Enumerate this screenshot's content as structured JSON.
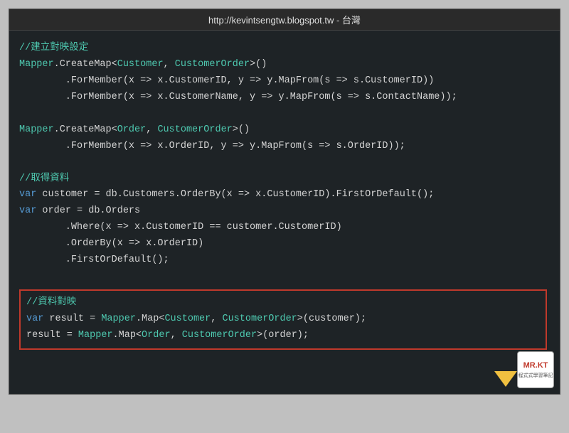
{
  "titleBar": {
    "text": "http://kevintsengtw.blogspot.tw - 台灣"
  },
  "code": {
    "section1_comment": "//建立對映設定",
    "line1": "Mapper.CreateMap<Customer, CustomerOrder>()",
    "line2": "        .ForMember(x => x.CustomerID, y => y.MapFrom(s => s.CustomerID))",
    "line3": "        .ForMember(x => x.CustomerName, y => y.MapFrom(s => s.ContactName));",
    "line4": "Mapper.CreateMap<Order, CustomerOrder>()",
    "line5": "        .ForMember(x => x.OrderID, y => y.MapFrom(s => s.OrderID));",
    "section2_comment": "//取得資料",
    "line6": "var customer = db.Customers.OrderBy(x => x.CustomerID).FirstOrDefault();",
    "line7": "var order = db.Orders",
    "line8": "        .Where(x => x.CustomerID == customer.CustomerID)",
    "line9": "        .OrderBy(x => x.OrderID)",
    "line10": "        .FirstOrDefault();",
    "section3_comment": "//資料對映",
    "line11": "var result = Mapper.Map<Customer, CustomerOrder>(customer);",
    "line12": "result = Mapper.Map<Order, CustomerOrder>(order);"
  },
  "badge": {
    "title": "MR.KT",
    "sub": "程式式學習筆記"
  }
}
